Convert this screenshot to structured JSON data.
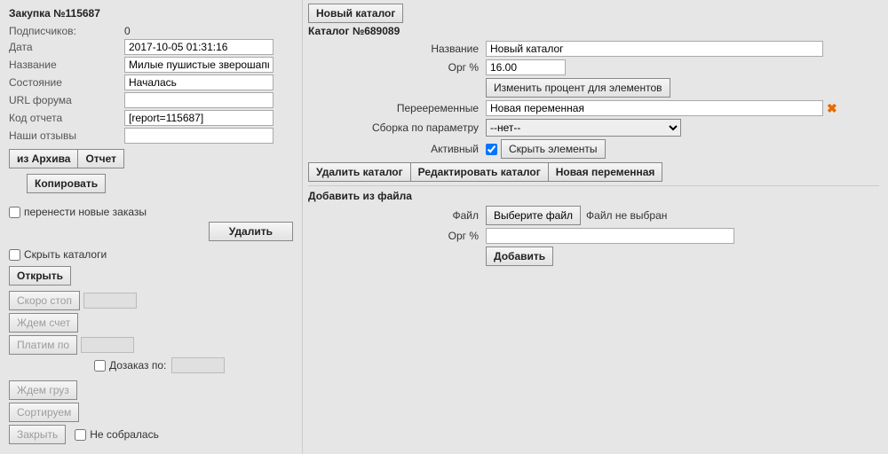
{
  "left": {
    "title": "Закупка №115687",
    "rows": {
      "subscribers_label": "Подписчиков:",
      "subscribers_value": "0",
      "date_label": "Дата",
      "date_value": "2017-10-05 01:31:16",
      "name_label": "Название",
      "name_value": "Милые пушистые зверошапки",
      "state_label": "Состояние",
      "state_value": "Началась",
      "forum_label": "URL форума",
      "forum_value": "",
      "report_label": "Код отчета",
      "report_value": "[report=115687]",
      "reviews_label": "Наши отзывы",
      "reviews_value": ""
    },
    "buttons": {
      "from_archive": "из Архива",
      "report": "Отчет",
      "copy": "Копировать",
      "move_orders_label": "перенести новые заказы",
      "delete": "Удалить",
      "hide_catalogs_label": "Скрыть каталоги",
      "open": "Открыть",
      "soon_stop": "Скоро стоп",
      "wait_bill": "Ждем счет",
      "pay_by": "Платим по",
      "reorder_by": "Дозаказ по:",
      "wait_cargo": "Ждем груз",
      "sorting": "Сортируем",
      "close": "Закрыть",
      "not_collected": "Не собралась"
    }
  },
  "right": {
    "new_catalog_btn": "Новый каталог",
    "catalog_title": "Каталог №689089",
    "fields": {
      "name_label": "Название",
      "name_value": "Новый каталог",
      "org_label": "Орг %",
      "org_value": "16.00",
      "change_percent_btn": "Изменить процент для элементов",
      "variables_label": "Перееременные",
      "variables_value": "Новая переменная",
      "assembly_label": "Сборка по параметру",
      "assembly_value": "--нет--",
      "active_label": "Активный",
      "hide_elements_label": "Скрыть элементы"
    },
    "catalog_btns": {
      "delete": "Удалить каталог",
      "edit": "Редактировать каталог",
      "new_var": "Новая переменная"
    },
    "add_file": {
      "title": "Добавить из файла",
      "file_label": "Файл",
      "choose_file": "Выберите файл",
      "no_file": "Файл не выбран",
      "org_label": "Орг %",
      "org_value": "",
      "add_btn": "Добавить"
    }
  }
}
